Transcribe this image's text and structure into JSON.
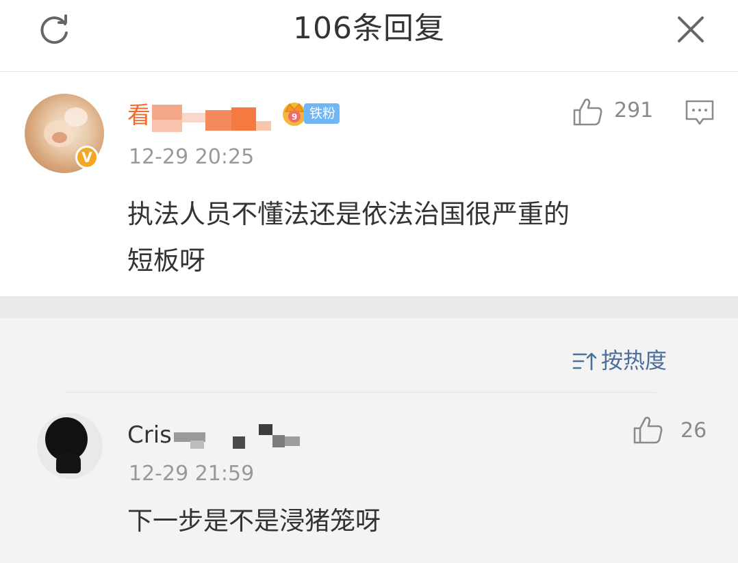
{
  "header": {
    "title": "106条回复",
    "refresh_icon": "refresh-icon",
    "close_icon": "close-icon"
  },
  "main_comment": {
    "username": "看",
    "fan_badge": "铁粉",
    "verified_icon": "verified-badge-icon",
    "verified_mark": "V",
    "timestamp": "12-29 20:25",
    "like_count": "291",
    "content_line1": "执法人员不懂法还是依法治国很严重的",
    "content_line2": "短板呀"
  },
  "sort": {
    "label": "按热度",
    "icon": "sort-icon"
  },
  "reply": {
    "username": "Cris",
    "timestamp": "12-29 21:59",
    "like_count": "26",
    "content": "下一步是不是浸猪笼呀"
  },
  "colors": {
    "username_orange": "#f36a2b",
    "sort_blue": "#4a6f9c",
    "fan_badge_blue": "#6fb6f5",
    "vip_gold": "#f5a623",
    "timestamp_gray": "#999999"
  }
}
